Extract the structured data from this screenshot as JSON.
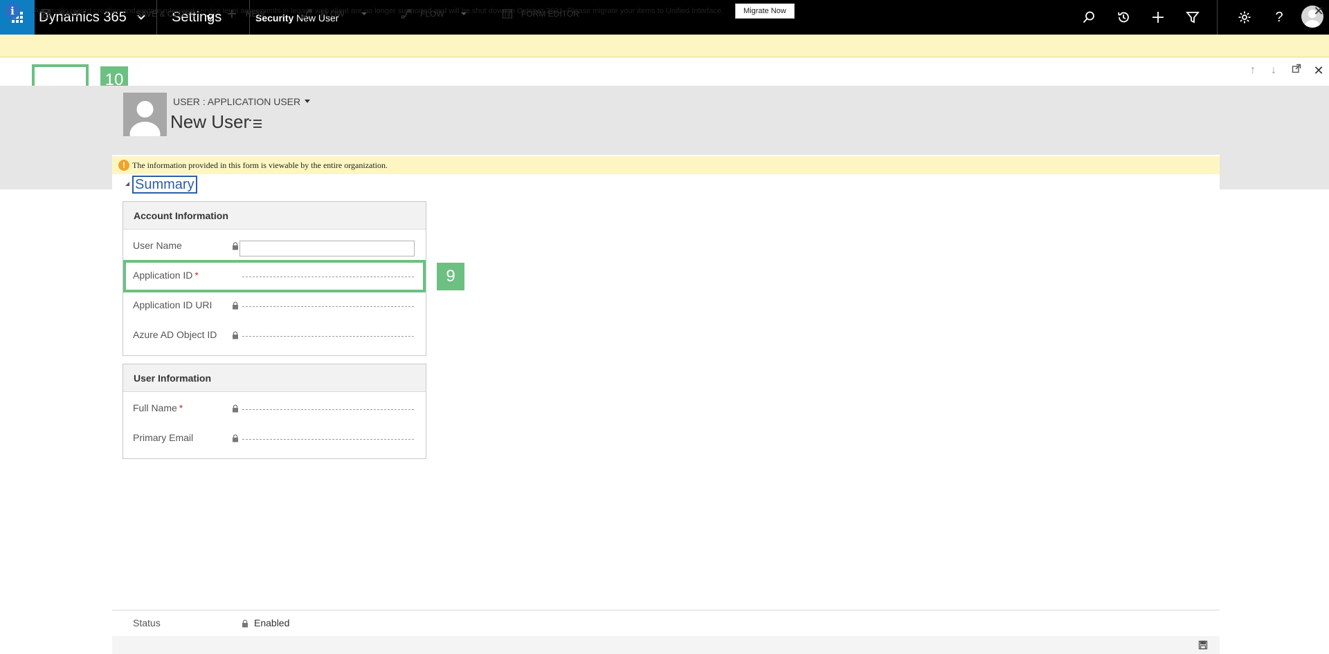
{
  "nav": {
    "app_name": "Dynamics 365",
    "area": "Settings",
    "breadcrumb": [
      "Security",
      "New User"
    ],
    "icons": [
      "search-icon",
      "recent-icon",
      "add-icon",
      "filter-icon",
      "gear-icon",
      "help-icon",
      "user-avatar"
    ]
  },
  "banner": {
    "text": "Automatic record creation and update rules and service level agreements in legacy web client are no longer supported and will be shut down in October 2021. Please migrate your items to Unified Interface.",
    "button": "Migrate Now"
  },
  "commands": {
    "save": "SAVE",
    "save_close": "SAVE & CLOSE",
    "new": "NEW",
    "flow1": "FLOW",
    "flow2": "FLOW",
    "form_editor": "FORM EDITOR"
  },
  "annotations": {
    "save_badge": "10",
    "app_id_badge": "9",
    "highlight_color": "#6cc082"
  },
  "header": {
    "entity_type": "USER : APPLICATION USER",
    "title": "New User"
  },
  "form": {
    "notice": "The information provided in this form is viewable by the entire organization.",
    "tab": "Summary",
    "account_section": {
      "title": "Account Information",
      "fields": {
        "user_name": "User Name",
        "application_id": "Application ID",
        "application_id_uri": "Application ID URI",
        "azure_ad_object_id": "Azure AD Object ID"
      },
      "required_marker": "*"
    },
    "user_section": {
      "title": "User Information",
      "fields": {
        "full_name": "Full Name",
        "primary_email": "Primary Email"
      }
    }
  },
  "footer": {
    "status_label": "Status",
    "status_value": "Enabled"
  }
}
